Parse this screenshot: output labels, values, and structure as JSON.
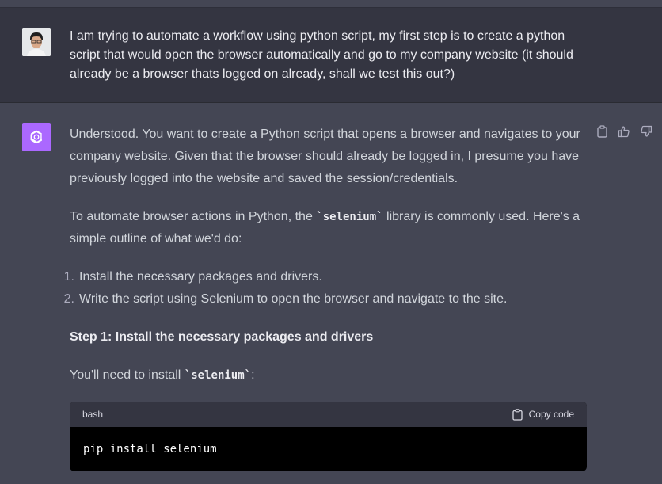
{
  "user_message": {
    "text": "I am trying to automate a workflow using python script, my first step is to create a python script that would open the browser automatically and go to my company website (it should already be a browser thats logged on already, shall we test this out?)"
  },
  "assistant_message": {
    "para1": "Understood. You want to create a Python script that opens a browser and navigates to your company website. Given that the browser should already be logged in, I presume you have previously logged into the website and saved the session/credentials.",
    "para2_before": "To automate browser actions in Python, the ",
    "para2_code": "`selenium`",
    "para2_after": " library is commonly used. Here's a simple outline of what we'd do:",
    "list": [
      {
        "num": "1.",
        "text": "Install the necessary packages and drivers."
      },
      {
        "num": "2.",
        "text": "Write the script using Selenium to open the browser and navigate to the site."
      }
    ],
    "step_title": "Step 1: Install the necessary packages and drivers",
    "para3_before": "You'll need to install ",
    "para3_code": "`selenium`",
    "para3_after": ":"
  },
  "code_block": {
    "language": "bash",
    "copy_label": "Copy code",
    "code": "pip install selenium"
  },
  "icons": {
    "copy": "clipboard-icon",
    "thumbs_up": "thumbs-up-icon",
    "thumbs_down": "thumbs-down-icon",
    "assistant": "openai-logo-icon"
  },
  "colors": {
    "assistant_avatar": "#ab68ff",
    "user_bg": "#343541",
    "assistant_bg": "#444654"
  }
}
